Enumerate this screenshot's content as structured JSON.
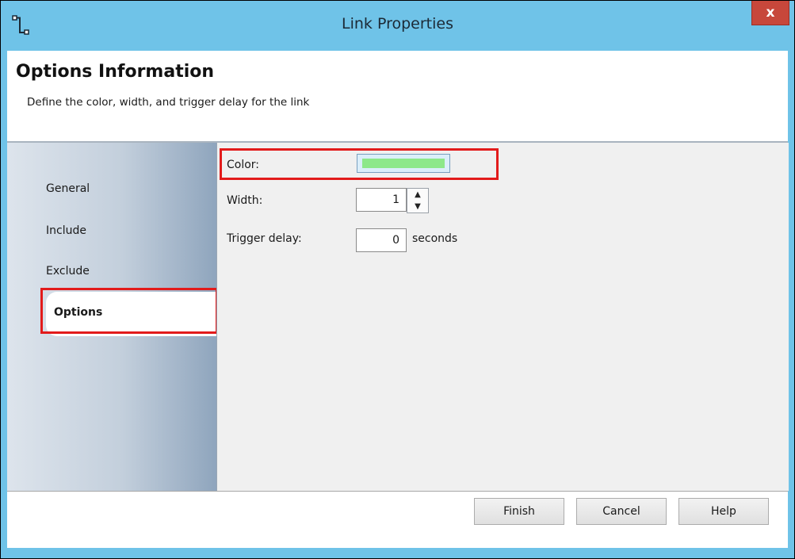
{
  "window": {
    "title": "Link Properties",
    "close_glyph": "x",
    "app_icon": "link-connector-icon"
  },
  "header": {
    "title": "Options Information",
    "subtitle": "Define the color, width, and trigger delay for the link"
  },
  "sidebar": {
    "items": [
      {
        "label": "General"
      },
      {
        "label": "Include"
      },
      {
        "label": "Exclude"
      },
      {
        "label": "Options",
        "selected": true
      }
    ]
  },
  "options": {
    "color_label": "Color:",
    "color_value": "#8de88a",
    "width_label": "Width:",
    "width_value": "1",
    "trigger_label": "Trigger delay:",
    "trigger_value": "0",
    "trigger_unit": "seconds"
  },
  "footer": {
    "finish": "Finish",
    "cancel": "Cancel",
    "help": "Help"
  },
  "colors": {
    "titlebar": "#6fc3e8",
    "close_button": "#c7473b",
    "highlight": "#e21b1b",
    "swatch": "#8de88a"
  }
}
